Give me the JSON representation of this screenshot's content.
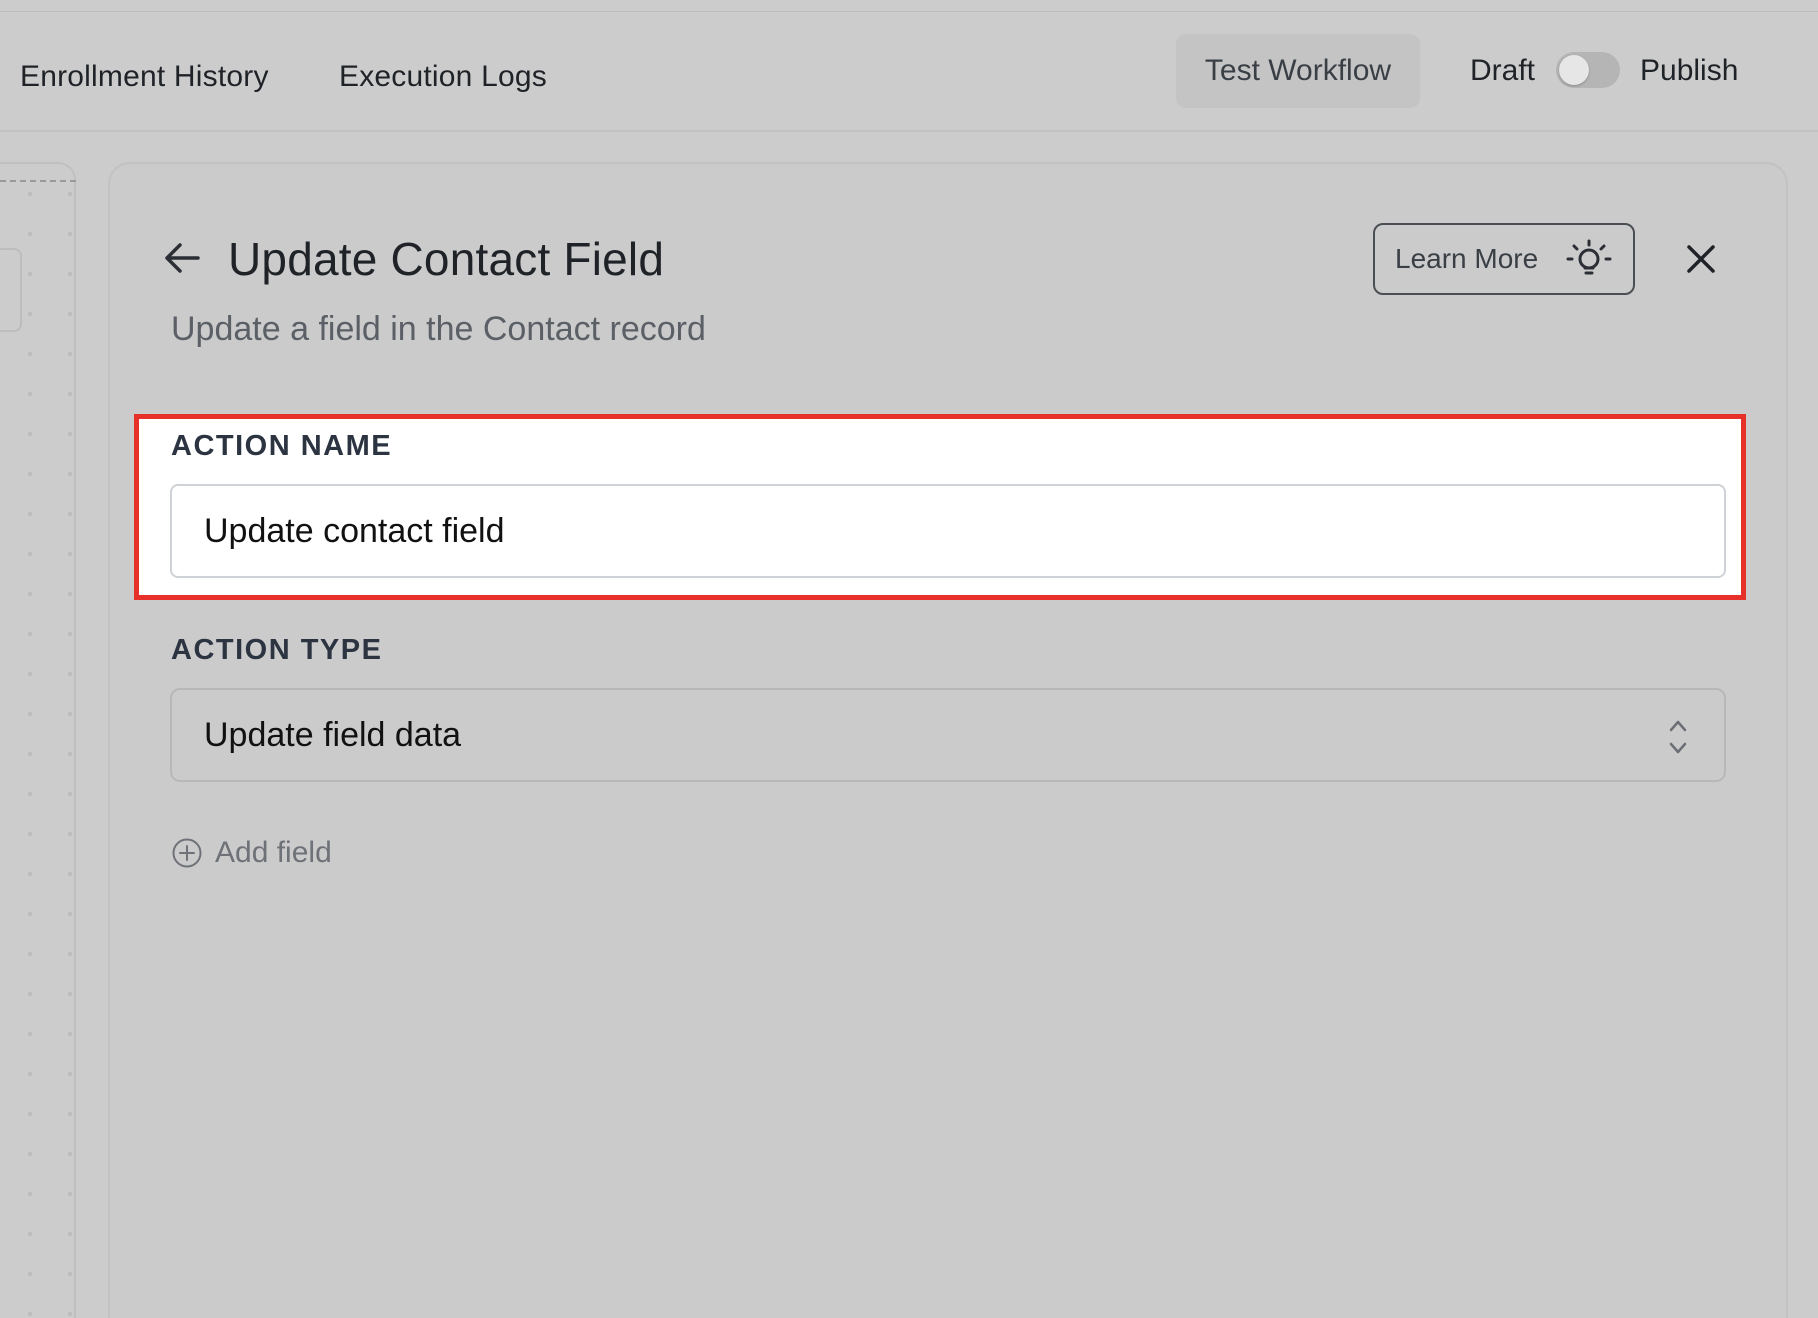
{
  "topbar": {
    "tabs": [
      {
        "label": "Enrollment History"
      },
      {
        "label": "Execution Logs"
      }
    ],
    "test_button": "Test Workflow",
    "draft_label": "Draft",
    "publish_label": "Publish",
    "publish_toggle": {
      "state": "off"
    }
  },
  "panel": {
    "title": "Update Contact Field",
    "subtitle": "Update a field in the Contact record",
    "learn_more_label": "Learn More",
    "fields": {
      "action_name": {
        "label": "ACTION NAME",
        "value": "Update contact field"
      },
      "action_type": {
        "label": "ACTION TYPE",
        "value": "Update field data"
      }
    },
    "add_field_label": "Add field"
  },
  "colors": {
    "highlight_border": "#e8302a",
    "background": "#cccccc"
  },
  "icons": [
    "back-arrow-icon",
    "lightbulb-icon",
    "close-icon",
    "chevrons-up-down-icon",
    "plus-circle-icon"
  ]
}
